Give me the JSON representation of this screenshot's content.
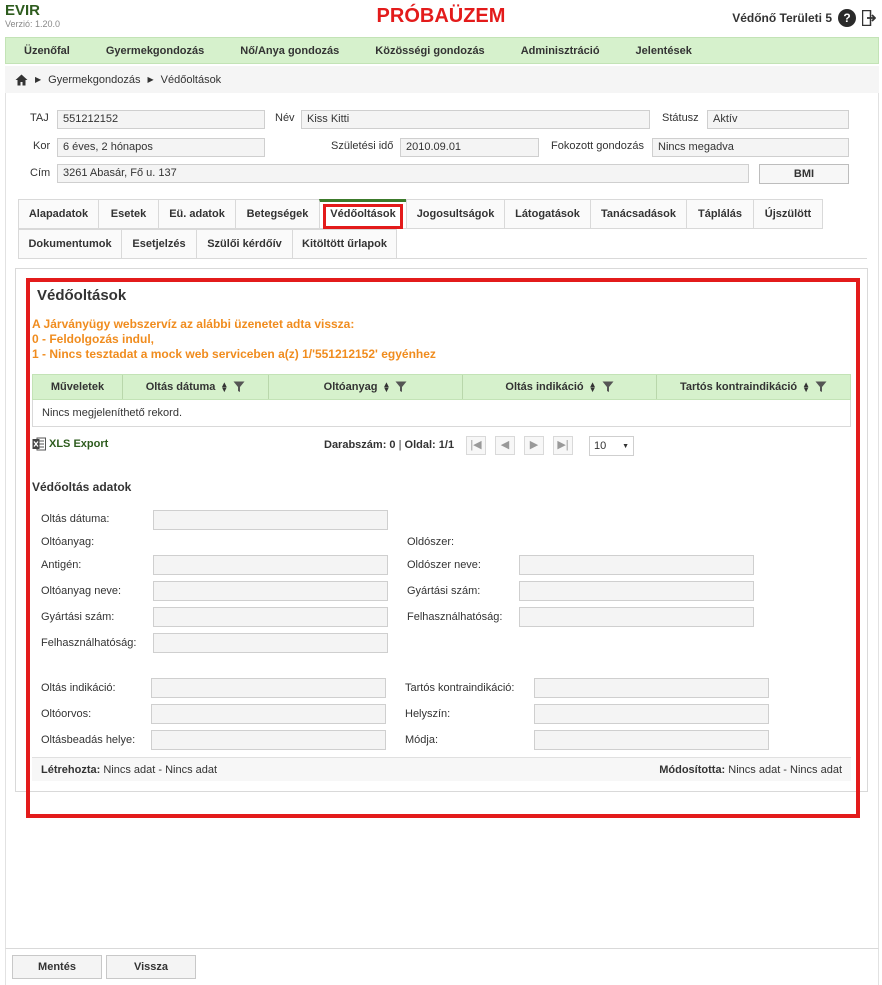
{
  "app": {
    "title": "EVIR",
    "version": "Verzió: 1.20.0",
    "environment": "PRÓBAÜZEM",
    "user": "Védőnő Területi 5",
    "help_label": "?"
  },
  "nav": [
    "Üzenőfal",
    "Gyermekgondozás",
    "Nő/Anya gondozás",
    "Közösségi gondozás",
    "Adminisztráció",
    "Jelentések"
  ],
  "breadcrumb": [
    "Gyermekgondozás",
    "Védőoltások"
  ],
  "patient": {
    "taj_label": "TAJ",
    "taj": "551212152",
    "name_label": "Név",
    "name": "Kiss Kitti",
    "status_label": "Státusz",
    "status": "Aktív",
    "age_label": "Kor",
    "age": "6 éves, 2 hónapos",
    "birth_label": "Születési idő",
    "birth": "2010.09.01",
    "care_label": "Fokozott gondozás",
    "care": "Nincs megadva",
    "address_label": "Cím",
    "address": "3261 Abasár, Fő u. 137",
    "bmi_label": "BMI"
  },
  "tabs_row1": [
    "Alapadatok",
    "Esetek",
    "Eü. adatok",
    "Betegségek",
    "Védőoltások",
    "Jogosultságok",
    "Látogatások",
    "Tanácsadások",
    "Táplálás",
    "Újszülött"
  ],
  "tabs_row2": [
    "Dokumentumok",
    "Esetjelzés",
    "Szülői kérdőív",
    "Kitöltött űrlapok"
  ],
  "active_tab": "Védőoltások",
  "section_title": "Védőoltások",
  "ws_messages": [
    "A Járványügy webszervíz az alábbi üzenetet adta vissza:",
    "0 - Feldolgozás indul,",
    "1 - Nincs tesztadat a mock web serviceben a(z) 1/'551212152' egyénhez"
  ],
  "grid": {
    "columns": [
      "Műveletek",
      "Oltás dátuma",
      "Oltóanyag",
      "Oltás indikáció",
      "Tartós kontraindikáció"
    ],
    "empty_text": "Nincs megjeleníthető rekord."
  },
  "export_label": "XLS Export",
  "pager": {
    "count_label": "Darabszám:",
    "count": "0",
    "separator": " | ",
    "page_label": "Oldal:",
    "page": "1/1",
    "page_size": "10"
  },
  "detail": {
    "title": "Védőoltás adatok",
    "labels": {
      "date": "Oltás dátuma:",
      "vaccine": "Oltóanyag:",
      "solvent": "Oldószer:",
      "antigen": "Antigén:",
      "solvent_name": "Oldószer neve:",
      "vaccine_name": "Oltóanyag neve:",
      "solvent_batch": "Gyártási szám:",
      "vaccine_batch": "Gyártási szám:",
      "solvent_expiry": "Felhasználhatóság:",
      "vaccine_expiry": "Felhasználhatóság:",
      "indication": "Oltás indikáció:",
      "contraindication": "Tartós kontraindikáció:",
      "doctor": "Oltóorvos:",
      "location": "Helyszín:",
      "admin_site": "Oltásbeadás helye:",
      "method": "Módja:"
    }
  },
  "audit": {
    "created_label": "Létrehozta:",
    "created": "Nincs adat - Nincs adat",
    "modified_label": "Módosította:",
    "modified": "Nincs adat - Nincs adat"
  },
  "footer": {
    "save": "Mentés",
    "back": "Vissza"
  },
  "colors": {
    "brand_green": "#2e5c1e",
    "nav_bg": "#d6f1cc",
    "alert_red": "#e31b1b",
    "warning_orange": "#f08c1e"
  }
}
